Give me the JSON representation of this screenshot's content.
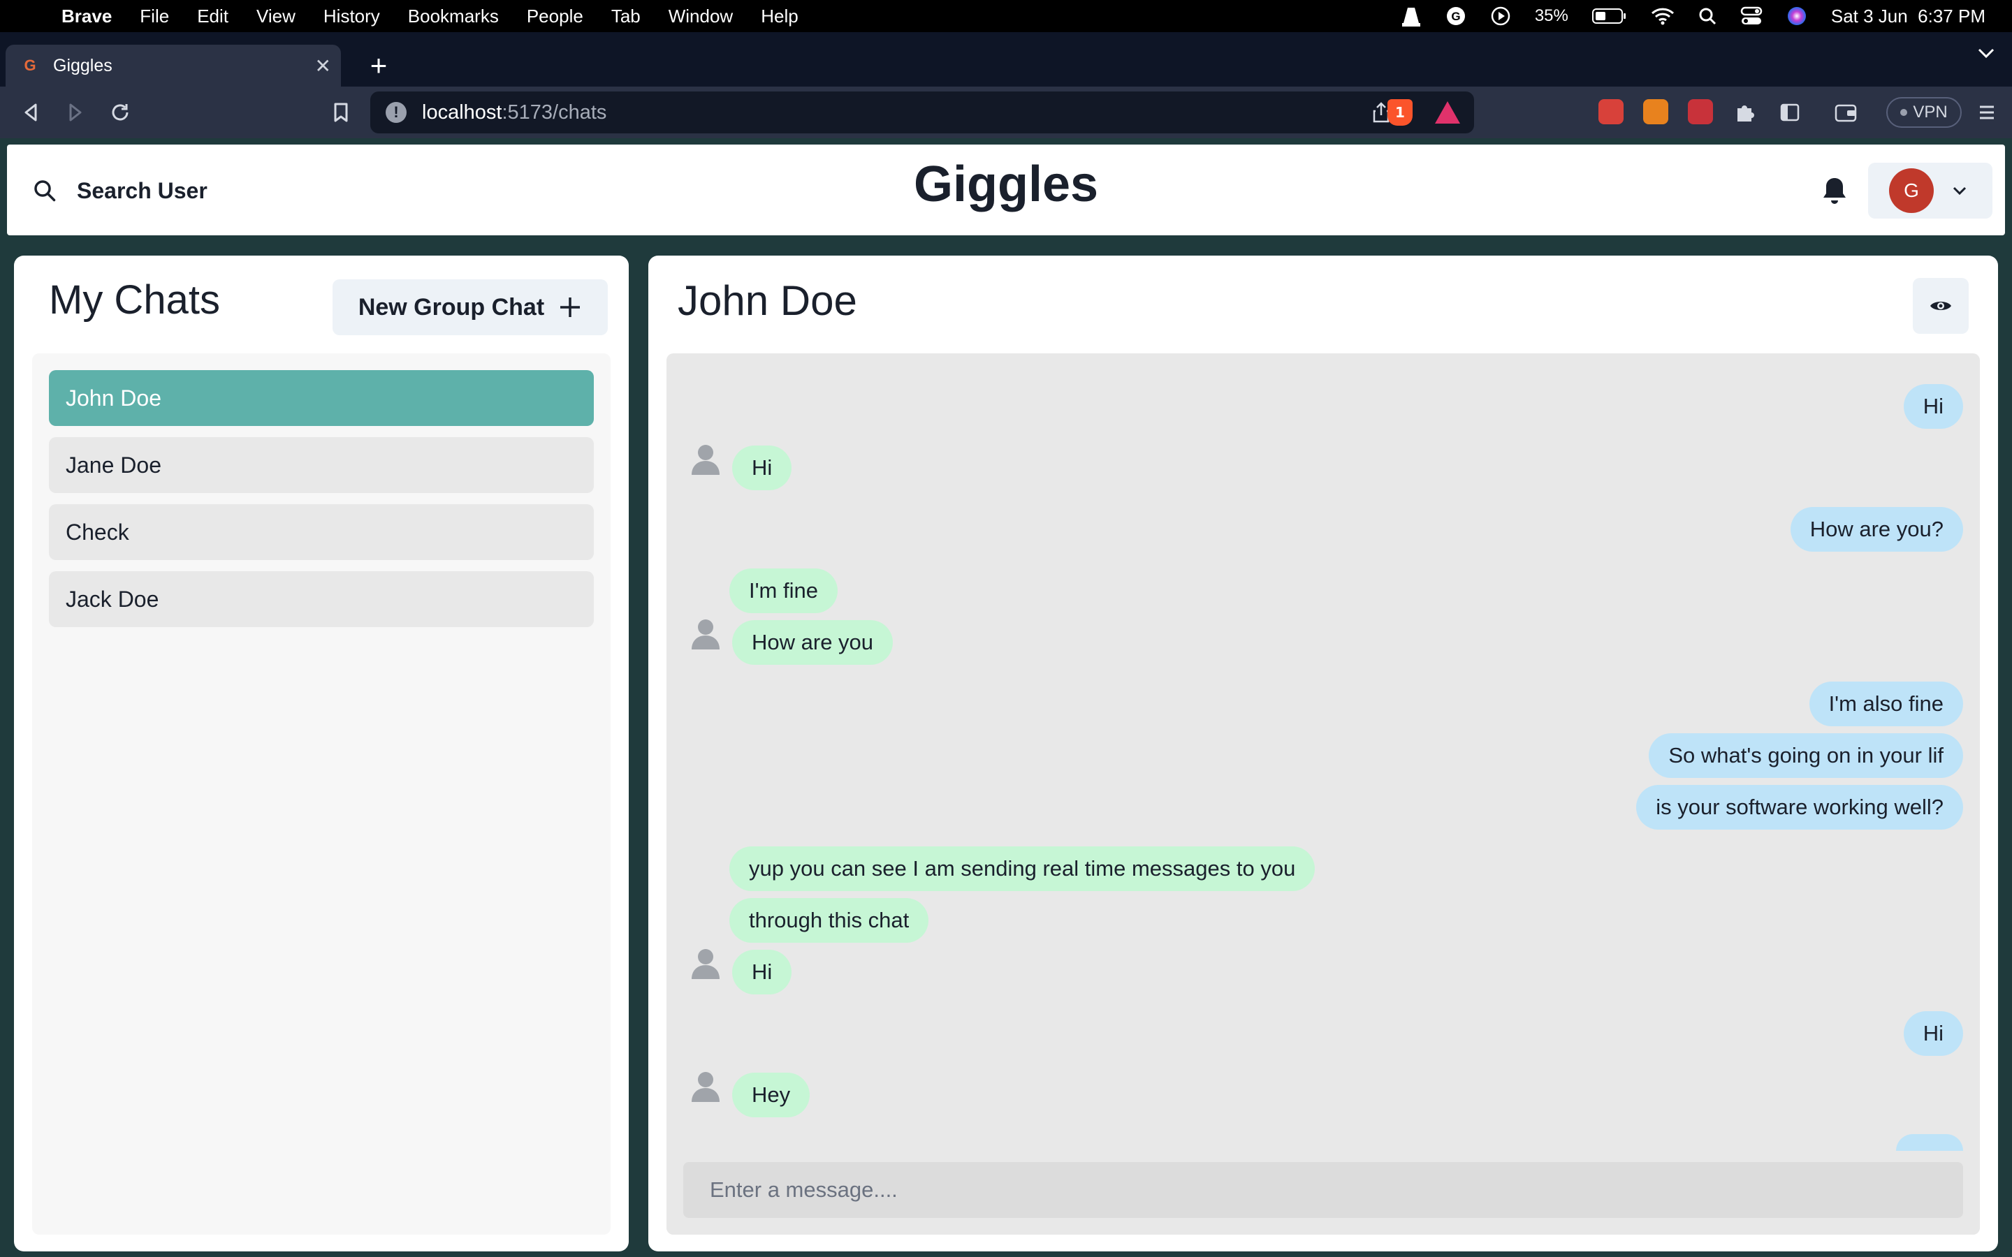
{
  "menubar": {
    "app": "Brave",
    "items": [
      "File",
      "Edit",
      "View",
      "History",
      "Bookmarks",
      "People",
      "Tab",
      "Window",
      "Help"
    ],
    "battery": "35%",
    "datetime": "Sat 3 Jun  6:37 PM"
  },
  "browser": {
    "tab_title": "Giggles",
    "url_host": "localhost",
    "url_path": ":5173/chats",
    "brave_badge": "1",
    "vpn_label": "VPN"
  },
  "header": {
    "search_label": "Search User",
    "app_title": "Giggles",
    "avatar_initial": "G"
  },
  "sidebar": {
    "title": "My Chats",
    "new_group_label": "New Group Chat",
    "chats": [
      {
        "name": "John Doe"
      },
      {
        "name": "Jane Doe"
      },
      {
        "name": "Check"
      },
      {
        "name": "Jack Doe"
      }
    ]
  },
  "chat": {
    "title": "John Doe",
    "input_placeholder": "Enter a message....",
    "messages": [
      {
        "from": "me",
        "text": "Hi"
      },
      {
        "from": "them",
        "text": "Hi"
      },
      {
        "from": "me",
        "text": "How are you?"
      },
      {
        "from": "them",
        "text": "I'm fine"
      },
      {
        "from": "them",
        "text": "How are you"
      },
      {
        "from": "me",
        "text": "I'm also fine"
      },
      {
        "from": "me",
        "text": "So what's going on in your lif"
      },
      {
        "from": "me",
        "text": "is your software working well?"
      },
      {
        "from": "them",
        "text": "yup you can see I am sending real time messages to you"
      },
      {
        "from": "them",
        "text": "through this chat"
      },
      {
        "from": "them",
        "text": "Hi"
      },
      {
        "from": "me",
        "text": "Hi"
      },
      {
        "from": "them",
        "text": "Hey"
      }
    ]
  },
  "colors": {
    "active_chat": "#5eb1aa",
    "my_bubble": "#bee3f8",
    "their_bubble": "#c6f6d5",
    "page_bg": "#1f3a3c"
  }
}
